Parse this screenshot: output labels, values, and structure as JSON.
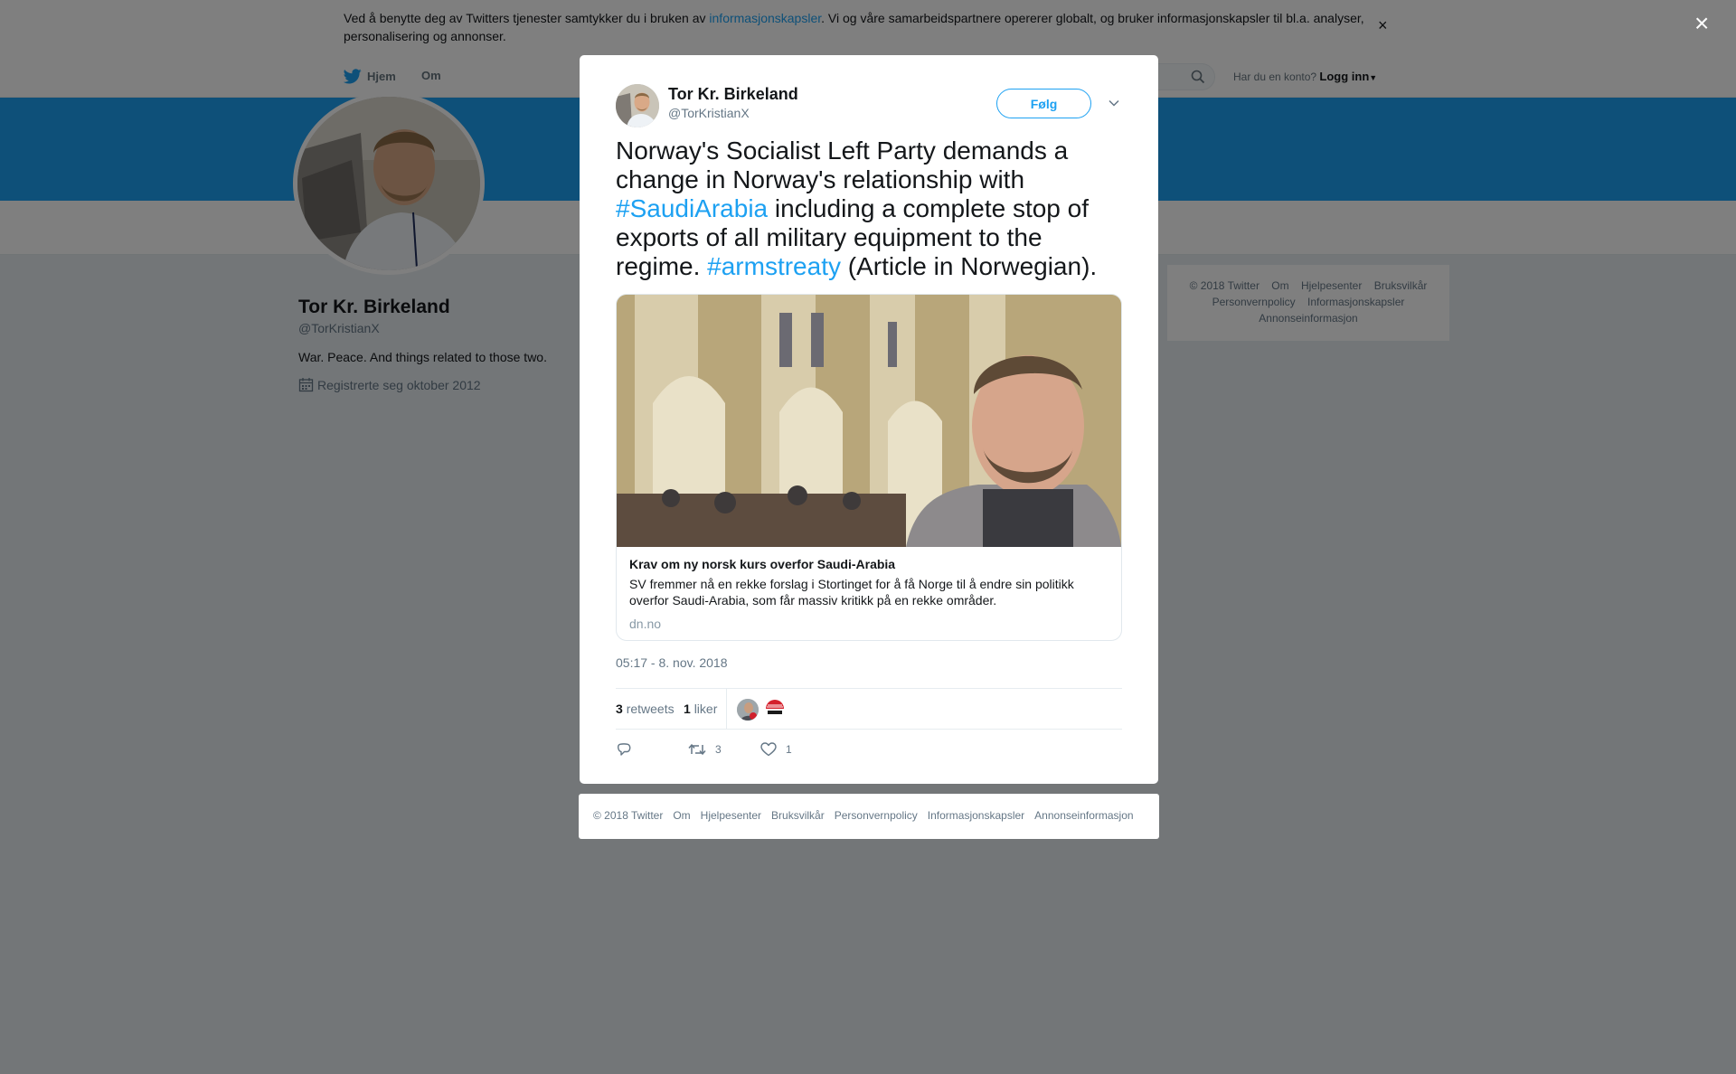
{
  "cookie_banner": {
    "text_before": "Ved å benytte deg av Twitters tjenester samtykker du i bruken av ",
    "link": "informasjonskapsler",
    "text_after": ". Vi og våre samarbeidspartnere opererer globalt, og bruker informasjonskapsler til bl.a. analyser, personalisering og annonser.",
    "close": "×"
  },
  "nav": {
    "home": "Hjem",
    "about": "Om",
    "account_prompt": "Har du en konto?",
    "login": "Logg inn"
  },
  "profile": {
    "name": "Tor Kr. Birkeland",
    "handle": "@TorKristianX",
    "bio": "War. Peace. And things related to those two.",
    "joined": "Registrerte seg oktober 2012"
  },
  "side_footer": {
    "links": [
      "© 2018 Twitter",
      "Om",
      "Hjelpesenter",
      "Bruksvilkår",
      "Personvernpolicy",
      "Informasjonskapsler",
      "Annonseinformasjon"
    ]
  },
  "overlay_close": "×",
  "tweet": {
    "author_name": "Tor Kr. Birkeland",
    "author_handle": "@TorKristianX",
    "follow_label": "Følg",
    "text_1": "Norway's Socialist Left Party demands a change in Norway's relationship with ",
    "hashtag_1": "#SaudiArabia",
    "text_2": " including a complete stop of exports of all military equipment to the regime. ",
    "hashtag_2": "#armstreaty",
    "text_3": " (Article in Norwegian).",
    "card": {
      "title": "Krav om ny norsk kurs overfor Saudi-Arabia",
      "description": "SV fremmer nå en rekke forslag i Stortinget for å få Norge til å endre sin politikk overfor Saudi-Arabia, som får massiv kritikk på en rekke områder.",
      "domain": "dn.no"
    },
    "timestamp": "05:17 - 8. nov. 2018",
    "retweet_count": "3",
    "retweet_label": "retweets",
    "like_count": "1",
    "like_label": "liker",
    "action_retweet_count": "3",
    "action_like_count": "1"
  },
  "modal_footer": {
    "links": [
      "© 2018 Twitter",
      "Om",
      "Hjelpesenter",
      "Bruksvilkår",
      "Personvernpolicy",
      "Informasjonskapsler",
      "Annonseinformasjon"
    ]
  },
  "colors": {
    "twitter_blue": "#1da1f2",
    "overlay": "rgba(0,0,0,0.5)",
    "secondary_text": "#657786"
  }
}
